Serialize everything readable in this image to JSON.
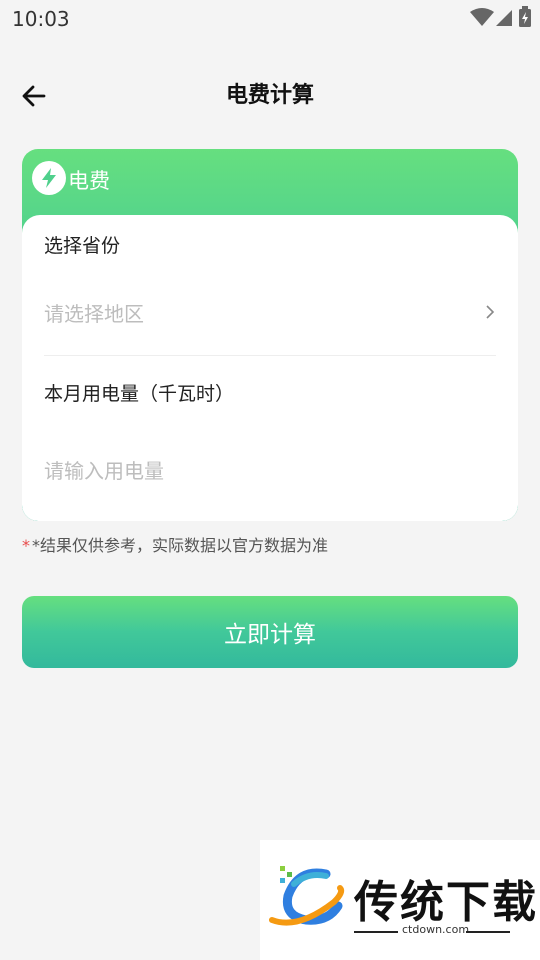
{
  "status_bar": {
    "time": "10:03",
    "icons": [
      "wifi-icon",
      "signal-icon",
      "battery-charging-icon"
    ]
  },
  "header": {
    "title": "电费计算",
    "back_icon": "arrow-left-icon"
  },
  "card": {
    "header_icon": "lightning-icon",
    "header_title": "电费",
    "province_label": "选择省份",
    "region_placeholder": "请选择地区",
    "usage_label": "本月用电量（千瓦时）",
    "usage_placeholder": "请输入用电量"
  },
  "note": {
    "asterisk": "*",
    "text": "*结果仅供参考，实际数据以官方数据为准"
  },
  "actions": {
    "calculate_label": "立即计算"
  },
  "watermark": {
    "brand": "传统下载",
    "domain": "ctdown.com"
  },
  "colors": {
    "accent_top": "#66df7f",
    "accent_bottom": "#33b99c",
    "background": "#f4f4f4",
    "placeholder": "#bdbdbd",
    "required_mark": "#e84a4a"
  }
}
